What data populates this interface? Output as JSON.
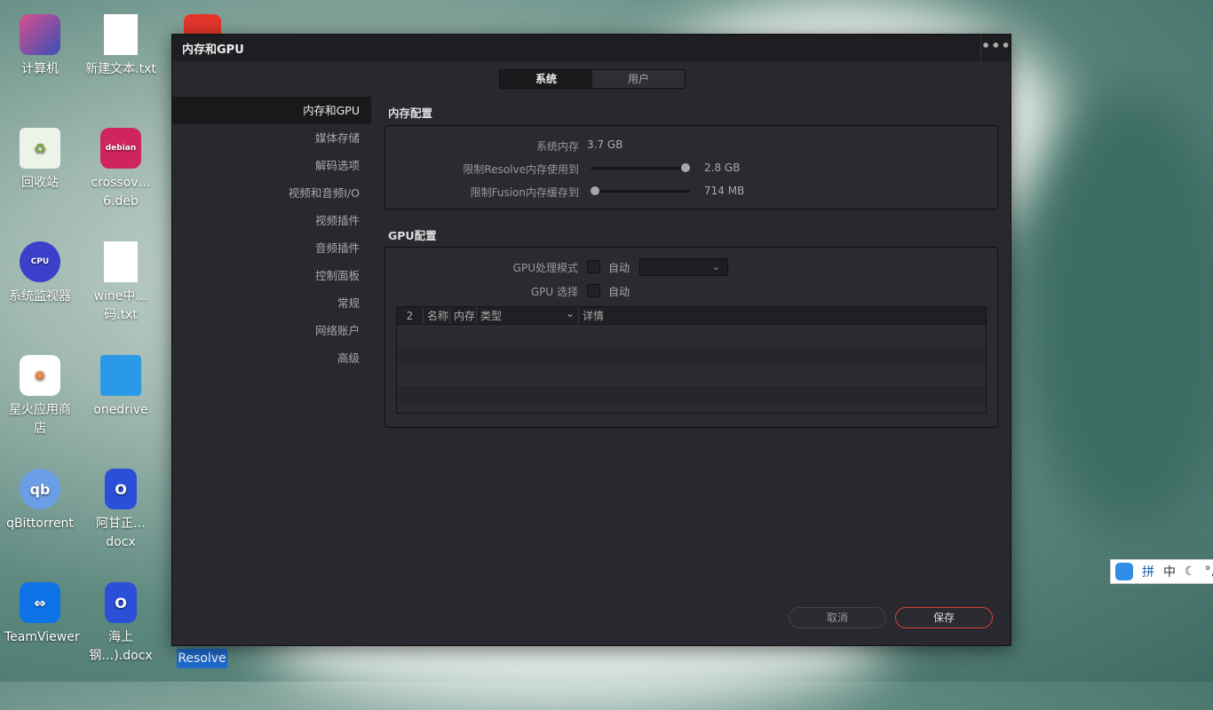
{
  "desktop": {
    "icons": [
      {
        "label": "计算机",
        "icon": "computer-icon"
      },
      {
        "label": "新建文本.txt",
        "icon": "text-file-icon"
      },
      {
        "label": "回收站",
        "icon": "trash-icon"
      },
      {
        "label": "crossov…6.deb",
        "icon": "deb-package-icon"
      },
      {
        "label": "系统监视器",
        "icon": "system-monitor-icon"
      },
      {
        "label": "wine中…码.txt",
        "icon": "text-file-icon"
      },
      {
        "label": "星火应用商店",
        "icon": "app-store-icon"
      },
      {
        "label": "onedrive",
        "icon": "folder-icon"
      },
      {
        "label": "qBittorrent",
        "icon": "qbittorrent-icon"
      },
      {
        "label": "阿甘正…docx",
        "icon": "office-doc-icon"
      },
      {
        "label": "TeamViewer",
        "icon": "teamviewer-icon"
      },
      {
        "label": "海上钢…).docx",
        "icon": "office-doc-icon"
      }
    ],
    "selected_label": "Resolve",
    "ime": {
      "mode": "拼",
      "lang": "中",
      "punct": "°,"
    }
  },
  "dialog": {
    "title": "内存和GPU",
    "more": "•••",
    "tabs": [
      {
        "label": "系统",
        "active": true
      },
      {
        "label": "用户",
        "active": false
      }
    ],
    "sidebar": [
      "内存和GPU",
      "媒体存储",
      "解码选项",
      "视频和音频I/O",
      "视频插件",
      "音频插件",
      "控制面板",
      "常规",
      "网络账户",
      "高级"
    ],
    "memory": {
      "title": "内存配置",
      "system_label": "系统内存",
      "system_value": "3.7 GB",
      "resolve_label": "限制Resolve内存使用到",
      "resolve_value": "2.8 GB",
      "resolve_fraction": 1.0,
      "fusion_label": "限制Fusion内存缓存到",
      "fusion_value": "714 MB",
      "fusion_fraction": 0.0
    },
    "gpu": {
      "title": "GPU配置",
      "mode_label": "GPU处理模式",
      "mode_auto": "自动",
      "select_label": "GPU 选择",
      "select_auto": "自动",
      "table_headers": [
        "2",
        "名称",
        "内存",
        "类型",
        "详情"
      ]
    },
    "buttons": {
      "cancel": "取消",
      "save": "保存"
    },
    "accent": "#d2453a"
  }
}
